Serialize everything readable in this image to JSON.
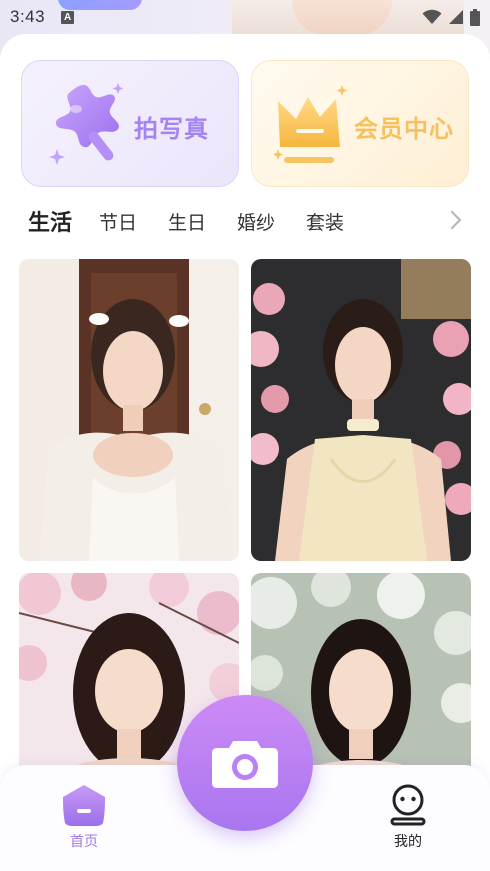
{
  "status_bar": {
    "time": "3:43",
    "notification_badge": "A",
    "icons": [
      "wifi-icon",
      "signal-icon",
      "battery-icon"
    ]
  },
  "feature_cards": [
    {
      "label": "拍写真",
      "icon": "magic-wand-icon"
    },
    {
      "label": "会员中心",
      "icon": "crown-icon"
    }
  ],
  "category_tabs": {
    "items": [
      "生活",
      "节日",
      "生日",
      "婚纱",
      "套装"
    ],
    "active": "生活",
    "more_icon": "chevron-right-icon"
  },
  "photo_cards": [
    {
      "theme": "white-dress-indoor"
    },
    {
      "theme": "cream-halter-flowers"
    },
    {
      "theme": "cherry-blossom-portrait"
    },
    {
      "theme": "white-blossom-portrait"
    }
  ],
  "bottom_nav": {
    "home_label": "首页",
    "mine_label": "我的",
    "active": "首页",
    "camera_icon": "camera-icon"
  },
  "colors": {
    "accent_purple": "#a484f0",
    "accent_gold": "#f6c15d",
    "camera_gradient_top": "#cd8af5",
    "camera_gradient_bottom": "#a876f0"
  }
}
